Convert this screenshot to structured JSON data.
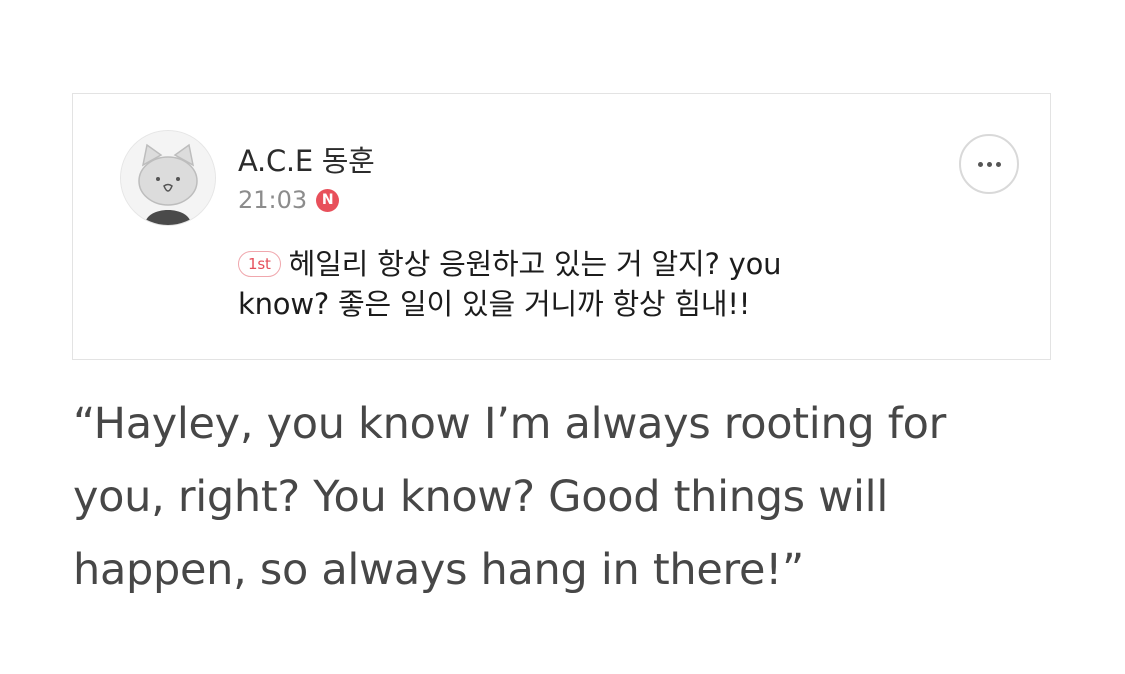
{
  "comment_card": {
    "avatar": {
      "icon": "cat-avatar-icon",
      "colors": {
        "background": "#f4f4f4",
        "face": "#dcdcdc",
        "body": "#4a4a4a"
      }
    },
    "author": "A.C.E 동훈",
    "time": "21:03",
    "new_badge": "N",
    "more_icon": "more-dots-icon",
    "rank_badge": "1st",
    "comment_line1": "헤일리 항상 응원하고 있는 거 알지? you",
    "comment_line2": "know? 좋은 일이 있을 거니까 항상 힘내!!"
  },
  "translation": {
    "line1": "“Hayley, you know I’m always rooting for",
    "line2": "you, right? You know? Good things will",
    "line3": "happen, so always hang in there!”"
  },
  "colors": {
    "accent": "#e8505b",
    "card_border": "#e3e3e3",
    "text_dark": "#1c1c1c",
    "text_muted": "#8c8c8c",
    "translation_text": "#474747"
  }
}
